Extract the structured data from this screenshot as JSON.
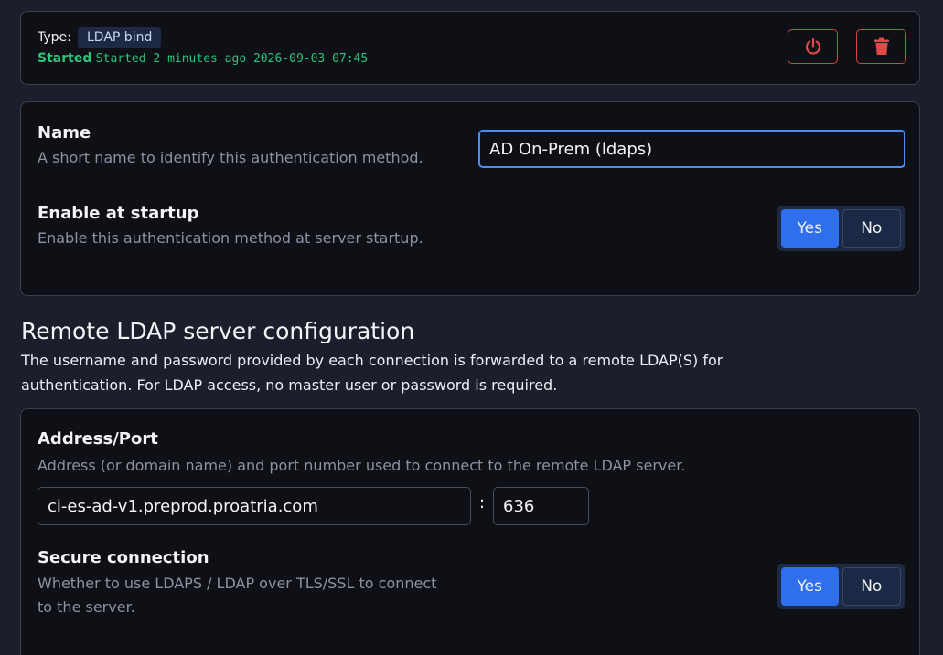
{
  "status": {
    "type_label": "Type:",
    "type_value": "LDAP bind",
    "state": "Started",
    "detail": "Started 2 minutes ago 2026-09-03 07:45",
    "power_icon": "power-icon",
    "delete_icon": "trash-icon",
    "danger_color": "#e04a4a"
  },
  "general": {
    "name_title": "Name",
    "name_desc": "A short name to identify this authentication method.",
    "name_value": "AD On-Prem (ldaps)",
    "startup_title": "Enable at startup",
    "startup_desc": "Enable this authentication method at server startup.",
    "startup_selected": "Yes",
    "yes_label": "Yes",
    "no_label": "No"
  },
  "remote": {
    "heading": "Remote LDAP server configuration",
    "description": "The username and password provided by each connection is forwarded to a remote LDAP(S) for authentication. For LDAP access, no master user or password is required.",
    "address_title": "Address/Port",
    "address_desc": "Address (or domain name) and port number used to connect to the remote LDAP server.",
    "address_value": "ci-es-ad-v1.preprod.proatria.com",
    "separator": ":",
    "port_value": "636",
    "secure_title": "Secure connection",
    "secure_desc_line1": "Whether to use LDAPS / LDAP over TLS/SSL to connect",
    "secure_desc_line2": "to the server.",
    "secure_selected": "Yes",
    "yes_label": "Yes",
    "no_label": "No"
  },
  "colors": {
    "accent": "#2f6fec",
    "success": "#2fc37b",
    "background": "#1b1e2b",
    "card": "#0e1016"
  }
}
